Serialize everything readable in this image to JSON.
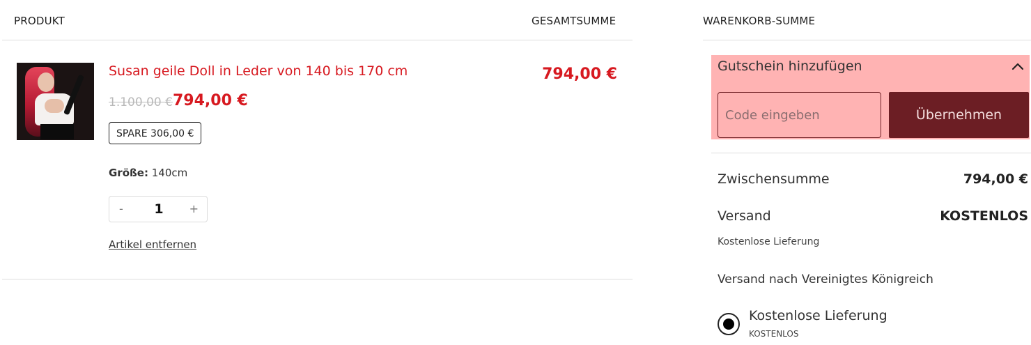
{
  "cart_table": {
    "col_product": "PRODUKT",
    "col_total": "GESAMTSUMME"
  },
  "item": {
    "title": "Susan geile Doll in Leder von 140 bis 170 cm",
    "old_price": "1.100,00 €",
    "price": "794,00 €",
    "save_badge": "SPARE 306,00 €",
    "size_label": "Größe:",
    "size_value": "140cm",
    "qty_minus": "-",
    "qty_value": "1",
    "qty_plus": "+",
    "remove_label": "Artikel entfernen",
    "line_total": "794,00 €"
  },
  "summary": {
    "heading": "WARENKORB-SUMME",
    "coupon_title": "Gutschein hinzufügen",
    "coupon_placeholder": "Code eingeben",
    "apply_label": "Übernehmen",
    "subtotal_label": "Zwischensumme",
    "subtotal_value": "794,00 €",
    "shipping_label": "Versand",
    "shipping_value": "KOSTENLOS",
    "shipping_note": "Kostenlose Lieferung",
    "shipping_destination": "Versand nach Vereinigtes Königreich",
    "option_label": "Kostenlose Lieferung",
    "option_price": "KOSTENLOS"
  },
  "colors": {
    "accent_red": "#d71920",
    "coupon_bg": "#ffb3b3",
    "button_bg": "#6c1e24"
  },
  "icons": {
    "coupon_toggle": "chevron-up-icon",
    "shipping_radio": "radio-selected-icon"
  }
}
